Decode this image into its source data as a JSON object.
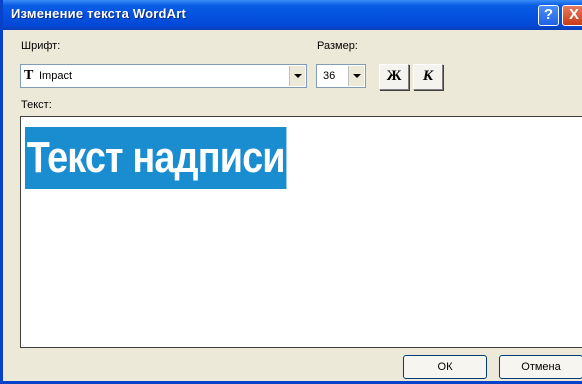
{
  "window": {
    "title": "Изменение текста WordArt",
    "help_label": "?",
    "close_label": "X"
  },
  "font": {
    "label": "Шрифт:",
    "value": "Impact",
    "icon": "truetype-icon"
  },
  "size": {
    "label": "Размер:",
    "value": "36"
  },
  "format": {
    "bold_label": "Ж",
    "italic_label": "К"
  },
  "text": {
    "label": "Текст:",
    "content": "Текст надписи",
    "selection_color": "#1a8cd0"
  },
  "buttons": {
    "ok_label": "ОК",
    "cancel_label": "Отмена"
  },
  "colors": {
    "titlebar": "#0453e0",
    "dialog_bg": "#ece9d8"
  }
}
